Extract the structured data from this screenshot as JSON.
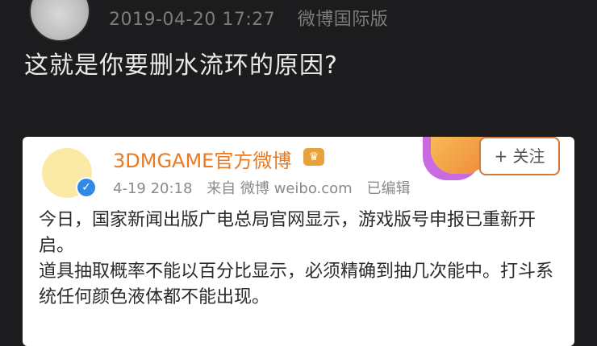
{
  "post": {
    "timestamp": "2019-04-20 17:27",
    "source": "微博国际版",
    "text": "这就是你要删水流环的原因?"
  },
  "quoted_card": {
    "author_name": "3DMGAME官方微博",
    "date": "4-19 20:18",
    "via": "来自 微博 weibo.com",
    "edited": "已编辑",
    "follow_label": "+ 关注",
    "paragraphs": [
      "今日，国家新闻出版广电总局官网显示，游戏版号申报已重新开启。",
      "道具抽取概率不能以百分比显示，必须精确到抽几次能中。打斗系统任何颜色液体都不能出现。"
    ]
  },
  "icons": {
    "verified": "verified-badge-icon",
    "crown": "vip-crown-icon"
  },
  "colors": {
    "background": "#1c1c1e",
    "author_name": "#ea7a22",
    "verified": "#2f89e6"
  }
}
